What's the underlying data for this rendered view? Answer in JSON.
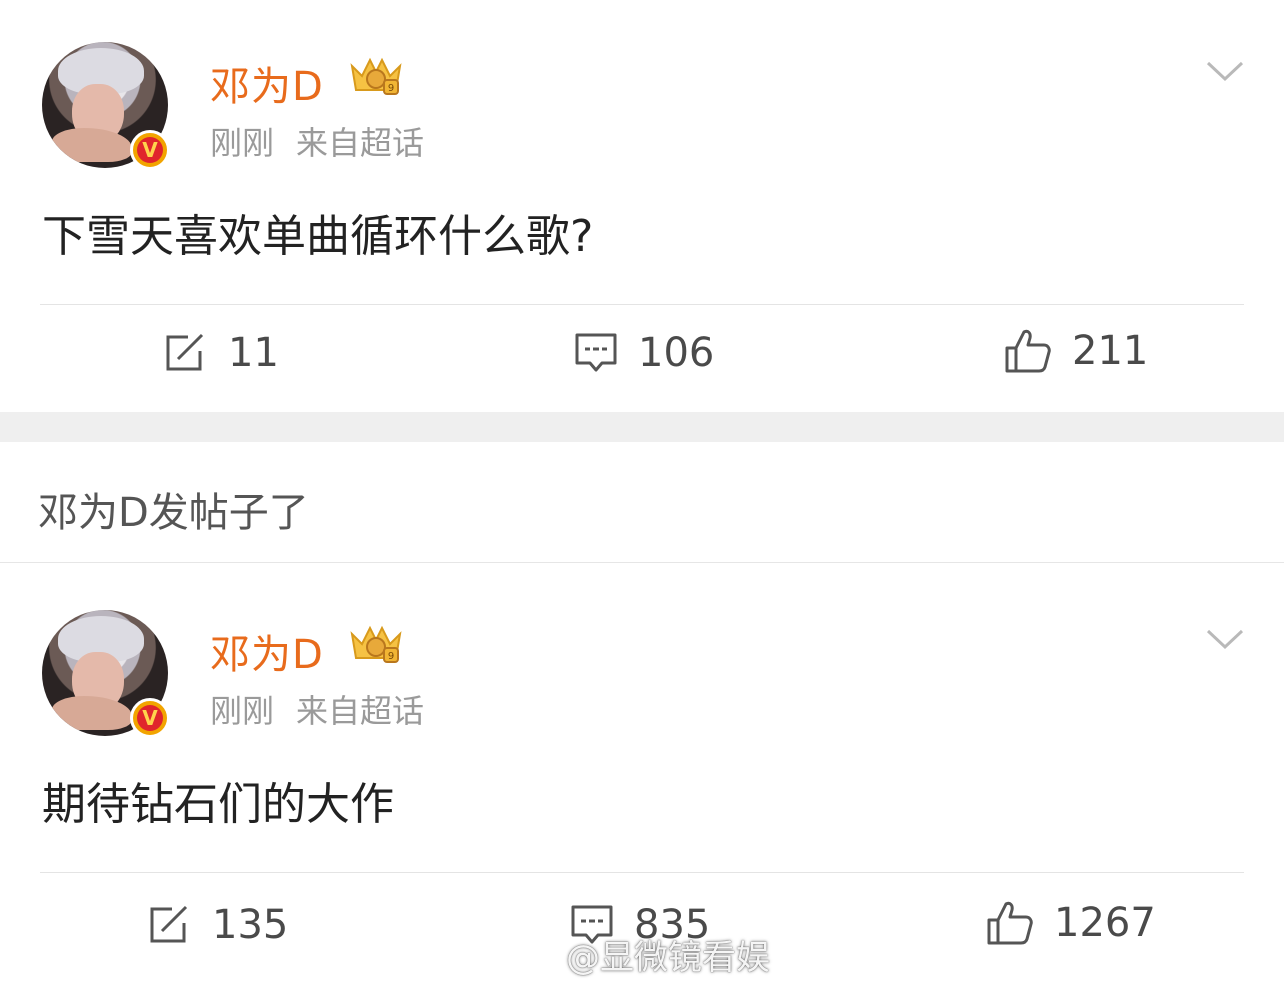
{
  "posts": [
    {
      "username": "邓为D",
      "time": "刚刚",
      "source": "来自超话",
      "content": "下雪天喜欢单曲循环什么歌?",
      "reposts": "11",
      "comments": "106",
      "likes": "211"
    },
    {
      "username": "邓为D",
      "time": "刚刚",
      "source": "来自超话",
      "content": "期待钻石们的大作",
      "reposts": "135",
      "comments": "835",
      "likes": "1267"
    }
  ],
  "notice": "邓为D发帖子了",
  "watermark": "@显微镜看娱",
  "colors": {
    "username": "#e86b1c",
    "meta": "#9a9a9a",
    "badge_ring": "#f2a400",
    "badge_fill": "#e0252c"
  },
  "icons": [
    "repost-icon",
    "comment-icon",
    "like-icon",
    "chevron-down-icon",
    "crown-badge-icon",
    "verified-v-icon",
    "weibo-logo-icon"
  ]
}
